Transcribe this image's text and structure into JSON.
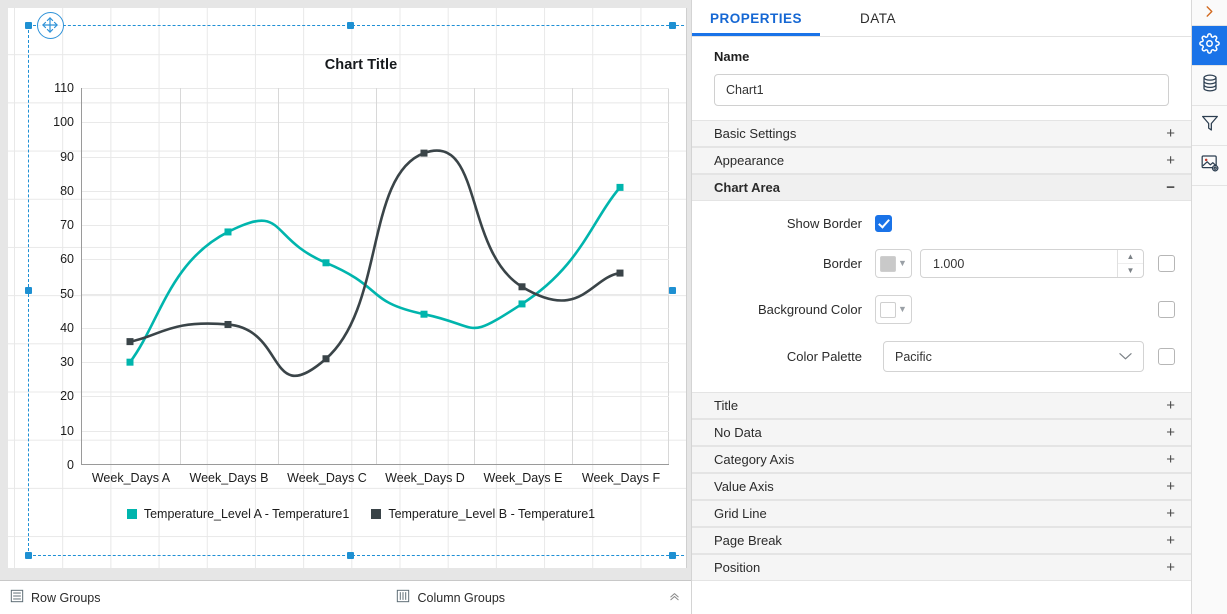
{
  "chart_data": {
    "type": "line",
    "title": "Chart Title",
    "xlabel": "",
    "ylabel": "",
    "ylim": [
      0,
      110
    ],
    "ytick_step": 10,
    "yticks": [
      0,
      10,
      20,
      30,
      40,
      50,
      60,
      70,
      80,
      90,
      100,
      110
    ],
    "categories": [
      "Week_Days A",
      "Week_Days B",
      "Week_Days C",
      "Week_Days D",
      "Week_Days E",
      "Week_Days F"
    ],
    "grid": true,
    "legend_position": "bottom",
    "smooth": true,
    "series": [
      {
        "name": "Temperature_Level A - Temperature1",
        "color": "#00b5ad",
        "values": [
          30,
          68,
          59,
          44,
          47,
          81
        ]
      },
      {
        "name": "Temperature_Level B - Temperature1",
        "color": "#3a4448",
        "values": [
          36,
          41,
          31,
          91,
          52,
          56
        ]
      }
    ]
  },
  "designer": {
    "move_handle_label": "move-handle",
    "groups_bar": {
      "row_groups": "Row Groups",
      "column_groups": "Column Groups"
    }
  },
  "panel": {
    "tabs": [
      {
        "label": "PROPERTIES",
        "active": true
      },
      {
        "label": "DATA",
        "active": false
      }
    ],
    "name_section": {
      "label": "Name",
      "value": "Chart1",
      "placeholder": "Name"
    },
    "sections": [
      {
        "label": "Basic Settings",
        "sign": "+",
        "open": false
      },
      {
        "label": "Appearance",
        "sign": "+",
        "open": false
      },
      {
        "label": "Chart Area",
        "sign": "−",
        "open": true
      }
    ],
    "chart_area": {
      "show_border": {
        "label": "Show Border",
        "checked": true
      },
      "border": {
        "label": "Border",
        "color": "#c9c9c9",
        "width_value": "1.000",
        "expr_checked": false
      },
      "background_color": {
        "label": "Background Color",
        "color": "#ffffff",
        "expr_checked": false
      },
      "color_palette": {
        "label": "Color Palette",
        "value": "Pacific",
        "expr_checked": false,
        "options": [
          "Pacific"
        ]
      }
    },
    "sections_below": [
      {
        "label": "Title",
        "sign": "+"
      },
      {
        "label": "No Data",
        "sign": "+"
      },
      {
        "label": "Category Axis",
        "sign": "+"
      },
      {
        "label": "Value Axis",
        "sign": "+"
      },
      {
        "label": "Grid Line",
        "sign": "+"
      },
      {
        "label": "Page Break",
        "sign": "+"
      },
      {
        "label": "Position",
        "sign": "+"
      }
    ]
  },
  "rail": {
    "items": [
      {
        "icon": "chevron-right-icon",
        "active": false
      },
      {
        "icon": "gear-icon",
        "active": true
      },
      {
        "icon": "database-icon",
        "active": false
      },
      {
        "icon": "filter-icon",
        "active": false
      },
      {
        "icon": "image-settings-icon",
        "active": false
      }
    ]
  },
  "theme": {
    "accent": "#1a73e8",
    "selection": "#1e8fd5",
    "series_a": "#00b5ad",
    "series_b": "#3a4448"
  }
}
